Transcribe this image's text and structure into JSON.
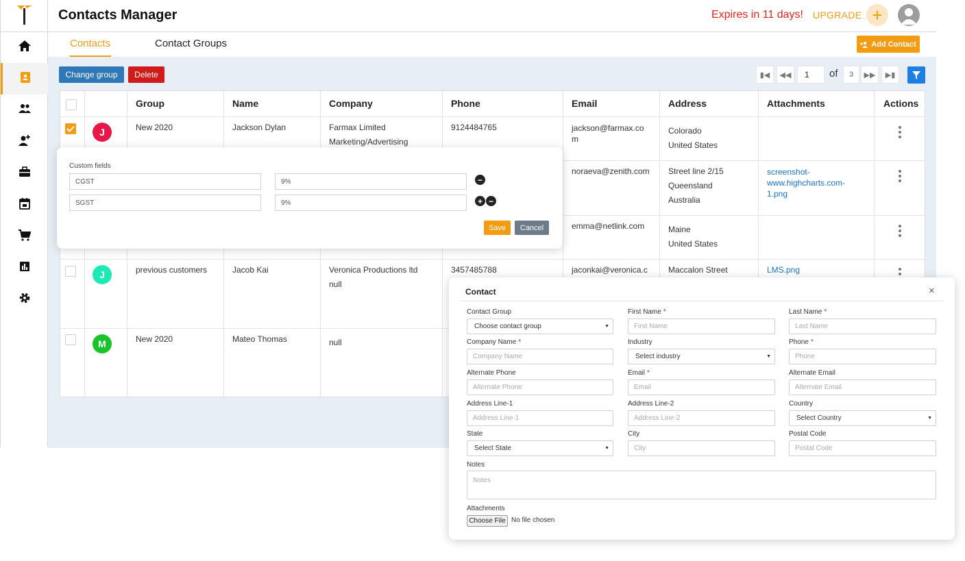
{
  "header": {
    "title": "Contacts Manager",
    "expires": "Expires in 11 days!",
    "upgrade": "UPGRADE",
    "plus": "+"
  },
  "tabs": {
    "contacts": "Contacts",
    "groups": "Contact Groups",
    "add_contact": "Add Contact"
  },
  "toolbar": {
    "change_group": "Change group",
    "delete": "Delete",
    "page": "1",
    "of": "of",
    "total_pages": "3"
  },
  "table": {
    "headers": [
      "Group",
      "Name",
      "Company",
      "Phone",
      "Email",
      "Address",
      "Attachments",
      "Actions"
    ],
    "rows": [
      {
        "group": "New 2020",
        "name": "Jackson Dylan",
        "company": [
          "Farmax Limited",
          "Marketing/Advertising"
        ],
        "phone": "9124484765",
        "email": [
          "jackson@farmax.co",
          "m"
        ],
        "address": [
          "Colorado",
          "United States"
        ],
        "attachment": [
          "",
          ""
        ],
        "initial": "J",
        "avatar_color": "#e8174a",
        "checked": true
      },
      {
        "email": [
          "noraeva@zenith.com"
        ],
        "address": [
          "Street line 2/15",
          "Queensland",
          "Australia"
        ],
        "attachment": [
          "screenshot-",
          "www.highcharts.com-",
          "1.png"
        ]
      },
      {
        "email": [
          "emma@netlink.com"
        ],
        "address": [
          "Maine",
          "United States"
        ]
      },
      {
        "group": "previous customers",
        "name": "Jacob Kai",
        "company": [
          "Veronica Productions ltd",
          "null"
        ],
        "phone": "3457485788",
        "email": [
          "jaconkai@veronica.c"
        ],
        "address": [
          "Maccalon Street"
        ],
        "attachment": [
          "LMS.png"
        ],
        "initial": "J",
        "avatar_color": "#1de9b6",
        "checked": false
      },
      {
        "group": "New 2020",
        "name": "Mateo Thomas",
        "company": [
          "null"
        ],
        "initial": "M",
        "avatar_color": "#19c32b",
        "checked": false
      }
    ]
  },
  "custom_fields": {
    "title": "Custom fields",
    "fields": [
      {
        "name": "CGST",
        "value": "9%"
      },
      {
        "name": "SGST",
        "value": "9%"
      }
    ],
    "save": "Save",
    "cancel": "Cancel"
  },
  "contact_modal": {
    "title": "Contact",
    "close": "×",
    "labels": {
      "contact_group": "Contact Group",
      "first_name": "First Name",
      "last_name": "Last Name",
      "company_name": "Company Name",
      "industry": "Industry",
      "phone": "Phone",
      "alternate_phone": "Alternate Phone",
      "email": "Email",
      "alternate_email": "Alternate Email",
      "address1": "Address Line-1",
      "address2": "Address Line-2",
      "country": "Country",
      "state": "State",
      "city": "City",
      "postal_code": "Postal Code",
      "notes": "Notes",
      "attachments": "Attachments"
    },
    "required_mark": "*",
    "placeholders": {
      "first_name": "First Name",
      "last_name": "Last Name",
      "company_name": "Company Name",
      "phone": "Phone",
      "alternate_phone": "Alternate Phone",
      "email": "Email",
      "alternate_email": "Alternate Email",
      "address1": "Address Line-1",
      "address2": "Address Line-2",
      "city": "City",
      "postal_code": "Postal Code",
      "notes": "Notes"
    },
    "selects": {
      "contact_group": "Choose contact group",
      "industry": "Select industry",
      "country": "Select Country",
      "state": "Select State"
    },
    "choose_file": "Choose File",
    "no_file": "No file chosen"
  },
  "colors": {
    "accent": "#f39c12",
    "primary": "#2e78b7",
    "danger": "#d11a1a",
    "link": "#1a73c9"
  }
}
